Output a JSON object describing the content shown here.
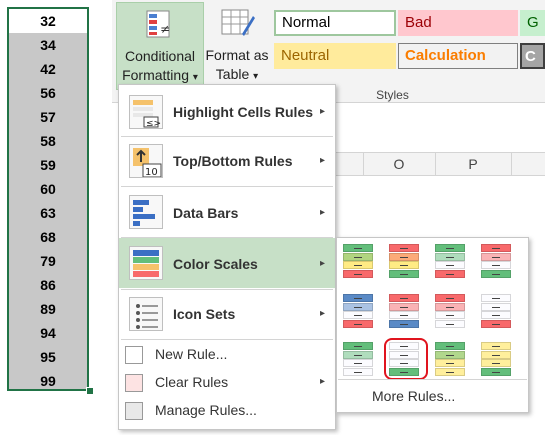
{
  "column": {
    "values": [
      "32",
      "34",
      "42",
      "56",
      "57",
      "58",
      "59",
      "60",
      "63",
      "68",
      "79",
      "86",
      "89",
      "94",
      "95",
      "99"
    ]
  },
  "ribbon": {
    "conditional_formatting_line1": "Conditional",
    "conditional_formatting_line2": "Formatting",
    "format_as_table_line1": "Format as",
    "format_as_table_line2": "Table",
    "dropdown_glyph": "▾",
    "styles_group_label": "Styles",
    "styles": {
      "normal": "Normal",
      "bad": "Bad",
      "good": "G",
      "neutral": "Neutral",
      "calculation": "Calculation",
      "check": "C"
    }
  },
  "sheet": {
    "columns": [
      "O",
      "P"
    ]
  },
  "menu": {
    "items": [
      {
        "label": "Highlight Cells Rules",
        "icon": "highlight-cells-icon"
      },
      {
        "label": "Top/Bottom Rules",
        "icon": "top-bottom-icon"
      },
      {
        "label": "Data Bars",
        "icon": "data-bars-icon"
      },
      {
        "label": "Color Scales",
        "icon": "color-scales-icon"
      },
      {
        "label": "Icon Sets",
        "icon": "icon-sets-icon"
      }
    ],
    "small_items": [
      {
        "label": "New Rule...",
        "icon": "new-rule-icon"
      },
      {
        "label": "Clear Rules",
        "icon": "clear-rules-icon"
      },
      {
        "label": "Manage Rules...",
        "icon": "manage-rules-icon"
      }
    ],
    "submenu_arrow": "▸",
    "icon_text_10": "10"
  },
  "color_scales": {
    "more_rules": "More Rules...",
    "selected_index": 9,
    "scales": [
      [
        "#63be7b",
        "#ffeb84",
        "#f8696b"
      ],
      [
        "#f8696b",
        "#ffeb84",
        "#63be7b"
      ],
      [
        "#63be7b",
        "#fcfcff",
        "#f8696b"
      ],
      [
        "#f8696b",
        "#fcfcff",
        "#63be7b"
      ],
      [
        "#5a8ac6",
        "#fcfcff",
        "#f8696b"
      ],
      [
        "#f8696b",
        "#fcfcff",
        "#5a8ac6"
      ],
      [
        "#f8696b",
        "#fcfcff",
        "#fcfcff"
      ],
      [
        "#fcfcff",
        "#fcfcff",
        "#f8696b"
      ],
      [
        "#63be7b",
        "#fcfcff",
        "#fcfcff"
      ],
      [
        "#fcfcff",
        "#fcfcff",
        "#63be7b"
      ],
      [
        "#63be7b",
        "#ffef9c",
        "#ffef9c"
      ],
      [
        "#ffef9c",
        "#ffef9c",
        "#63be7b"
      ]
    ]
  },
  "colors": {
    "accent_green": "#217346",
    "menu_highlight": "#c7e0c7",
    "selection_ring": "#e0141e"
  }
}
